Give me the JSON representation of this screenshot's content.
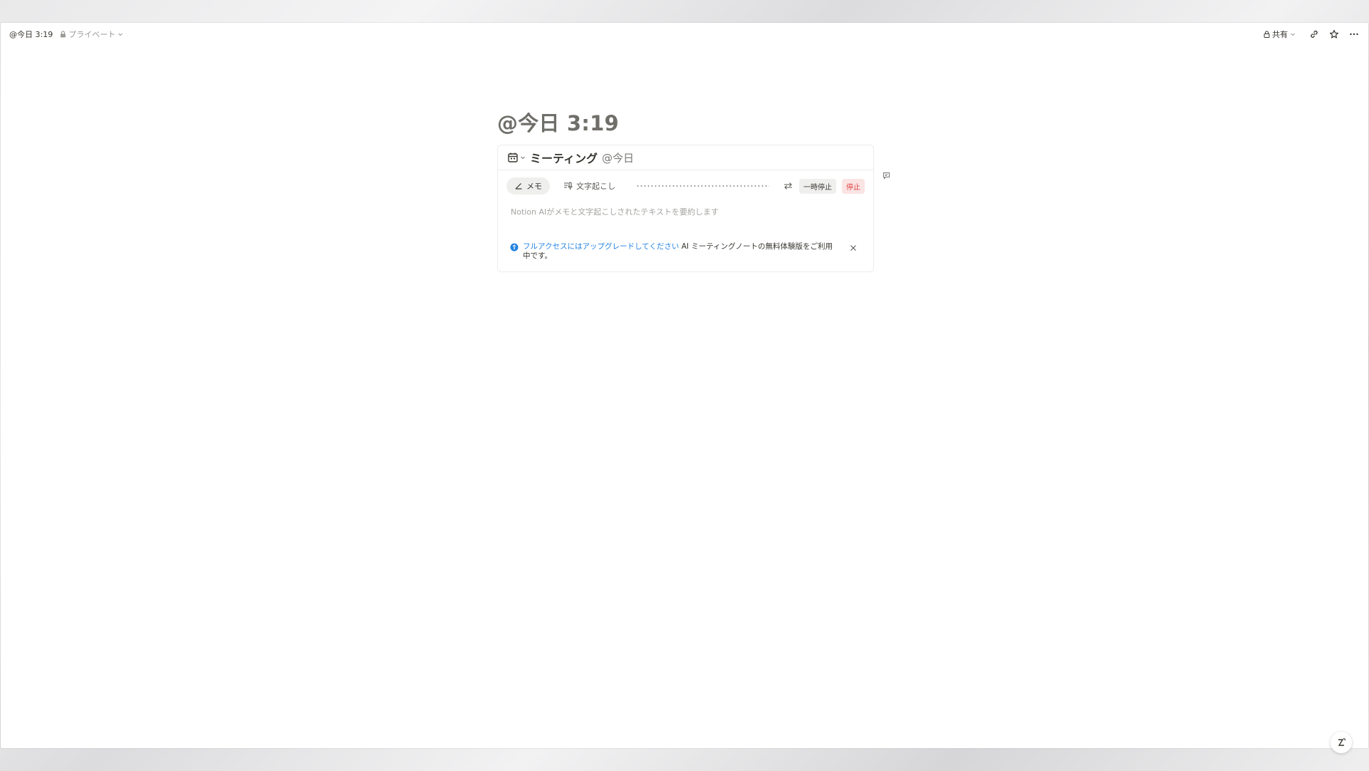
{
  "topbar": {
    "breadcrumb_title": "@今日 3:19",
    "privacy_label": "プライベート",
    "share_label": "共有"
  },
  "page": {
    "title": "@今日 3:19"
  },
  "meeting": {
    "name": "ミーティング",
    "date_mention": "@今日",
    "tabs": {
      "notes": "メモ",
      "transcript": "文字起こし"
    },
    "pause_label": "一時停止",
    "stop_label": "停止",
    "placeholder": "Notion AIがメモと文字起こしされたテキストを要約します",
    "notice": {
      "link_text": "フルアクセスにはアップグレードしてください",
      "body_text": " AI ミーティングノートの無料体験版をご利用中です。"
    }
  },
  "colors": {
    "link": "#2383e2",
    "stop": "#e03e3e",
    "stop_bg": "#fbe4e4",
    "title_gray": "#6f6e69"
  },
  "icons": {
    "lock": "lock-icon",
    "chevron": "chevron-down-icon",
    "link": "link-icon",
    "star": "star-icon",
    "more": "more-icon",
    "calendar": "calendar-icon",
    "pencil": "pencil-icon",
    "transcript": "transcript-icon",
    "swap": "swap-icon",
    "info": "info-icon",
    "close": "close-icon",
    "comment": "comment-icon",
    "help": "help-icon"
  }
}
